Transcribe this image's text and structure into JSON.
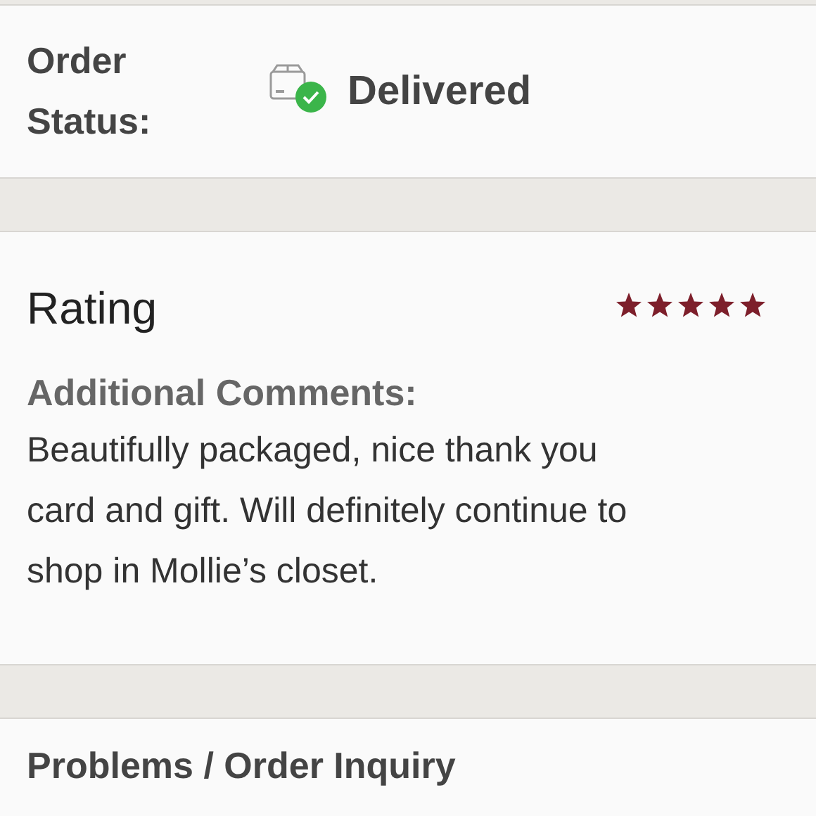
{
  "order_status": {
    "label": "Order Status:",
    "status": "Delivered"
  },
  "rating": {
    "title": "Rating",
    "stars": 5,
    "comments_label": "Additional Comments:",
    "comments": "Beautifully packaged, nice thank you card and gift. Will definitely continue to shop in Mollie’s closet."
  },
  "problems": {
    "title": "Problems / Order Inquiry"
  }
}
